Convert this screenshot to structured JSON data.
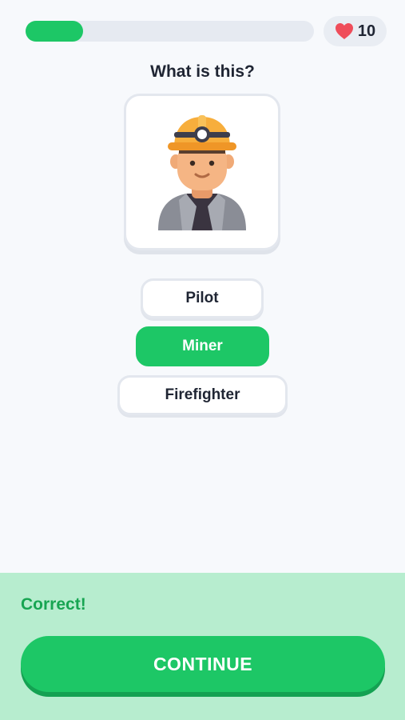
{
  "header": {
    "progress_fraction": 0.2,
    "hearts": {
      "count": "10",
      "icon": "heart-icon",
      "color": "#ef4d5a"
    }
  },
  "question": {
    "prompt": "What is this?",
    "image": "miner-illustration"
  },
  "options": [
    {
      "label": "Pilot",
      "state": "neutral"
    },
    {
      "label": "Miner",
      "state": "selected"
    },
    {
      "label": "Firefighter",
      "state": "neutral"
    }
  ],
  "feedback": {
    "message": "Correct!",
    "continue_label": "CONTINUE"
  },
  "colors": {
    "accent": "#1dc766",
    "feedback_bg": "#b7edcf",
    "feedback_text": "#17a552",
    "heart": "#ef4d5a"
  }
}
